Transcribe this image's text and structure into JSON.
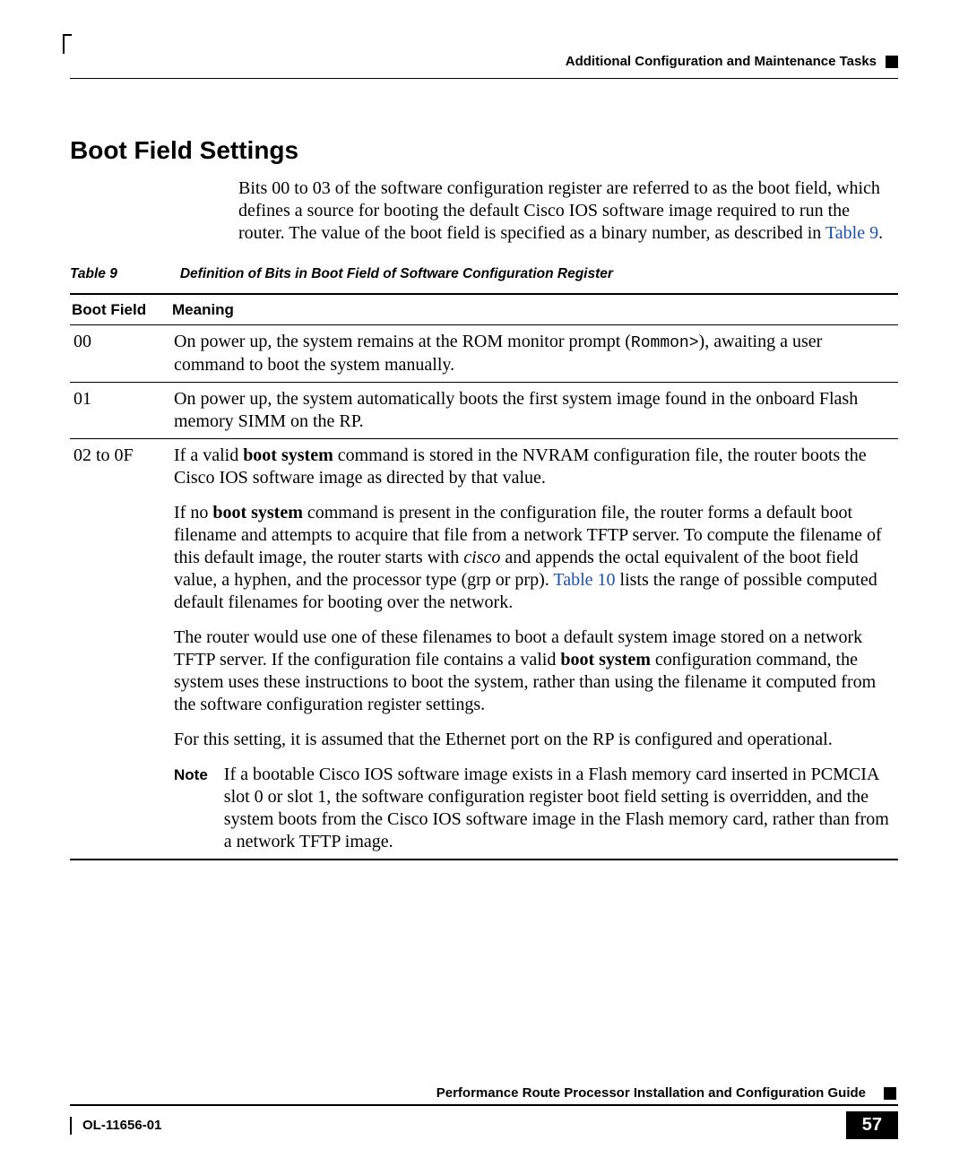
{
  "header": {
    "section": "Additional Configuration and Maintenance Tasks"
  },
  "heading": "Boot Field Settings",
  "intro": {
    "text_before": "Bits 00 to 03 of the software configuration register are referred to as the boot field, which defines a source for booting the default Cisco IOS software image required to run the router. The value of the boot field is specified as a binary number, as described in ",
    "xref": "Table 9",
    "text_after": "."
  },
  "table": {
    "label": "Table 9",
    "caption": "Definition of Bits in Boot Field of Software Configuration Register",
    "headers": {
      "c1": "Boot Field",
      "c2": "Meaning"
    },
    "rows": {
      "r00": {
        "field": "00",
        "m_a": "On power up, the system remains at the ROM monitor prompt (",
        "m_mono": "Rommon>",
        "m_b": "), awaiting a user command to boot the system manually."
      },
      "r01": {
        "field": "01",
        "m": "On power up, the system automatically boots the first system image found in the onboard Flash memory SIMM on the RP."
      },
      "r02": {
        "field": "02 to 0F",
        "p1_a": "If a valid ",
        "p1_bold1": "boot system",
        "p1_b": " command is stored in the NVRAM configuration file, the router boots the Cisco IOS software image as directed by that value.",
        "p2_a": "If no ",
        "p2_bold1": "boot system",
        "p2_b": " command is present in the configuration file, the router forms a default boot filename and attempts to acquire that file from a network TFTP server. To compute the filename of this default image, the router starts with ",
        "p2_ital": "cisco",
        "p2_c": " and appends the octal equivalent of the boot field value, a hyphen, and the processor type (grp or prp). ",
        "p2_xref": "Table 10",
        "p2_d": " lists the range of possible computed default filenames for booting over the network.",
        "p3_a": "The router would use one of these filenames to boot a default system image stored on a network TFTP server. If the configuration file contains a valid ",
        "p3_bold": "boot system",
        "p3_b": " configuration command, the system uses these instructions to boot the system, rather than using the filename it computed from the software configuration register settings.",
        "p4": "For this setting, it is assumed that the Ethernet port on the RP is configured and operational.",
        "note_label": "Note",
        "note": "If a bootable Cisco IOS software image exists in a Flash memory card inserted in PCMCIA slot 0 or slot 1, the software configuration register boot field setting is overridden, and the system boots from the Cisco IOS software image in the Flash memory card, rather than from a network TFTP image."
      }
    }
  },
  "footer": {
    "guide": "Performance Route Processor Installation and Configuration Guide",
    "docnum": "OL-11656-01",
    "page": "57"
  }
}
